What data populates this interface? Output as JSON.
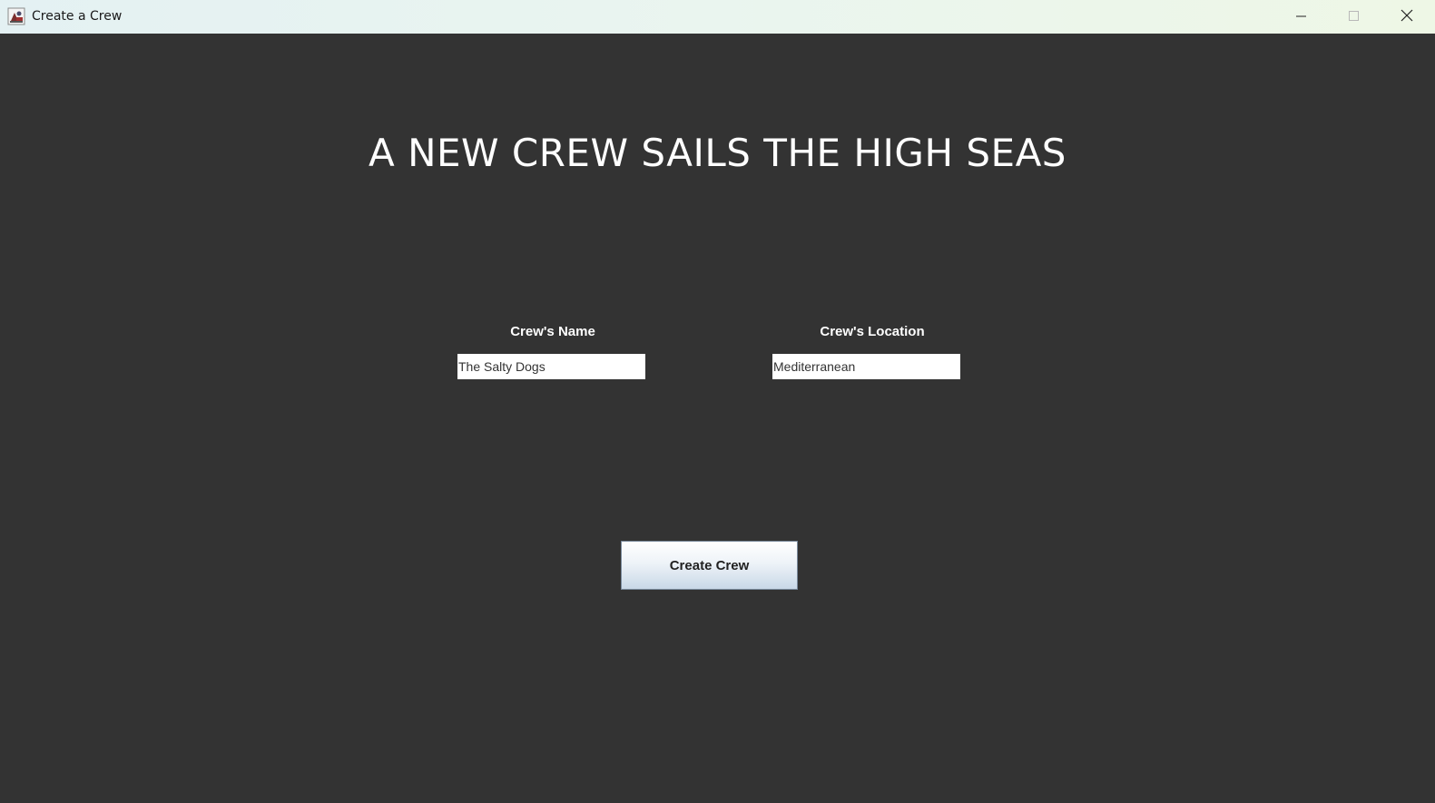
{
  "window": {
    "title": "Create a Crew",
    "icon": "java-app-icon",
    "controls": {
      "minimize": "minimize-icon",
      "maximize": "maximize-icon",
      "close": "close-icon"
    }
  },
  "main": {
    "heading": "A NEW CREW SAILS THE HIGH SEAS",
    "crew_name": {
      "label": "Crew's Name",
      "value": "The Salty Dogs"
    },
    "crew_location": {
      "label": "Crew's Location",
      "value": "Mediterranean"
    },
    "create_button_label": "Create Crew"
  },
  "colors": {
    "background": "#333333",
    "heading_text": "#ffffff",
    "field_background": "#ffffff"
  }
}
